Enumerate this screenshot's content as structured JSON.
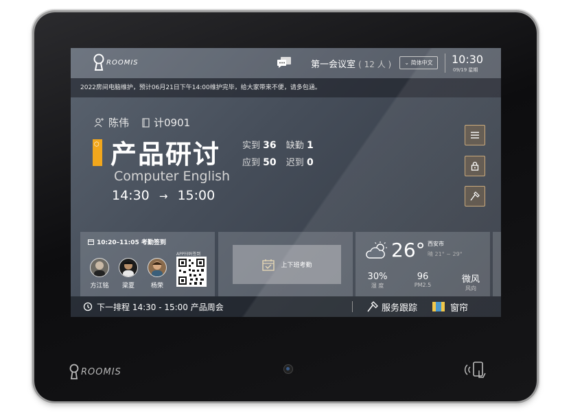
{
  "header": {
    "logo_text": "ROOMIS",
    "room_name": "第一会议室",
    "room_count": "( 12 人 )",
    "language_button": "简体中文",
    "time": "10:30",
    "date": "09/19 星期"
  },
  "notice": "2022房间电脑维护，预计06月21日下午14:00维护完毕，给大家带来不便，请多包涵。",
  "meeting": {
    "organizer": "陈伟",
    "department": "计0901",
    "title": "产品研讨",
    "subtitle": "Computer English",
    "start": "14:30",
    "arrow": "→",
    "end": "15:00",
    "stats": {
      "actual_label": "实到",
      "actual_value": "36",
      "absent_label": "缺勤",
      "absent_value": "1",
      "expected_label": "应到",
      "expected_value": "50",
      "late_label": "迟到",
      "late_value": "0"
    }
  },
  "side_buttons": [
    "menu-icon",
    "lock-icon",
    "hammer-icon"
  ],
  "checkin": {
    "time_range": "10:20–11:05 考勤签到",
    "attendees": [
      {
        "name": "方江铭"
      },
      {
        "name": "梁夏"
      },
      {
        "name": "杨荣"
      }
    ],
    "qr_label": "APP扫码签到"
  },
  "clock_in": {
    "label": "上下班考勤"
  },
  "weather": {
    "temperature": "26°",
    "city": "西安市",
    "range": "晴 21° ~ 29°",
    "humidity_value": "30%",
    "humidity_label": "湿 度",
    "pm_value": "96",
    "pm_label": "PM2.5",
    "wind_value": "微风",
    "wind_label": "风向"
  },
  "bottom": {
    "next_schedule": "下一排程  14:30 - 15:00 产品周会",
    "service_label": "服务跟踪",
    "curtain_label": "窗帘"
  },
  "bezel": {
    "logo_text": "ROOMIS"
  },
  "colors": {
    "accent": "#f2a71c",
    "button_border": "#c8a472"
  }
}
